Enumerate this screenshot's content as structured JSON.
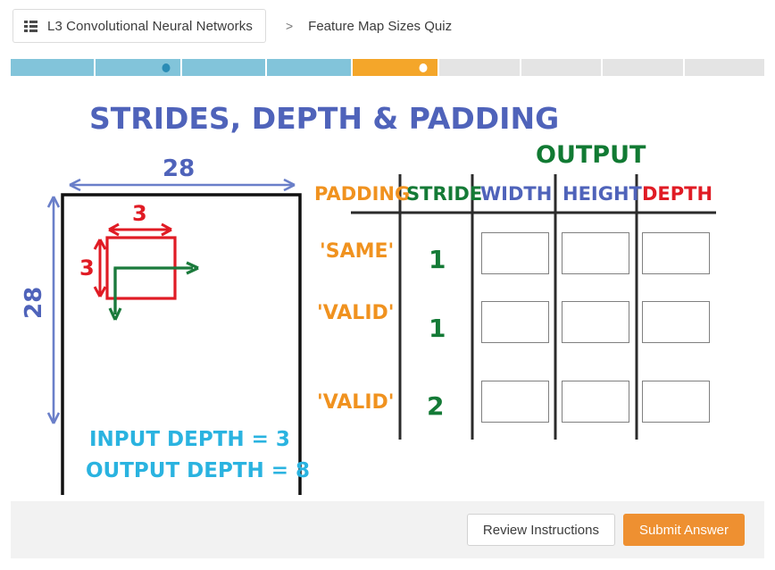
{
  "breadcrumb": {
    "menu_icon": "list-icon",
    "course": "L3 Convolutional Neural Networks",
    "separator": ">",
    "current": "Feature Map Sizes Quiz"
  },
  "progress": {
    "segments": [
      {
        "state": "complete",
        "color": "#82c4da",
        "dot": null
      },
      {
        "state": "complete",
        "color": "#82c4da",
        "dot": "#2b8cb5"
      },
      {
        "state": "complete",
        "color": "#82c4da",
        "dot": null
      },
      {
        "state": "complete",
        "color": "#82c4da",
        "dot": null
      },
      {
        "state": "current",
        "color": "#f4a62a",
        "dot": "#ffffff"
      },
      {
        "state": "upcoming",
        "color": "#e4e4e4",
        "dot": null
      },
      {
        "state": "upcoming",
        "color": "#e4e4e4",
        "dot": null
      },
      {
        "state": "upcoming",
        "color": "#e4e4e4",
        "dot": null
      },
      {
        "state": "upcoming",
        "color": "#e4e4e4",
        "dot": null
      }
    ]
  },
  "board": {
    "title": "STRIDES, DEPTH & PADDING",
    "output_label": "OUTPUT",
    "input": {
      "width_label": "28",
      "height_label": "28",
      "filter_width_label": "3",
      "filter_height_label": "3",
      "input_depth_text": "INPUT DEPTH = 3",
      "output_depth_text": "OUTPUT DEPTH = 8"
    },
    "colors": {
      "title": "#4f63ba",
      "output": "#117a33",
      "padding": "#f0921f",
      "stride": "#147a36",
      "width": "#4f63ba",
      "height": "#4f63ba",
      "depth": "#e01b24",
      "dimension": "#6a7fc9",
      "filter": "#e01b24",
      "arrow": "#1b7a3c",
      "depth_text": "#2ab3e0",
      "square": "#111111"
    },
    "table": {
      "headers": [
        {
          "label": "PADDING",
          "color": "#f0921f"
        },
        {
          "label": "STRIDE",
          "color": "#147a36"
        },
        {
          "label": "WIDTH",
          "color": "#4f63ba"
        },
        {
          "label": "HEIGHT",
          "color": "#4f63ba"
        },
        {
          "label": "DEPTH",
          "color": "#e01b24"
        }
      ],
      "rows": [
        {
          "padding": "'SAME'",
          "stride": "1",
          "width": "",
          "height": "",
          "depth": ""
        },
        {
          "padding": "'VALID'",
          "stride": "1",
          "width": "",
          "height": "",
          "depth": ""
        },
        {
          "padding": "'VALID'",
          "stride": "2",
          "width": "",
          "height": "",
          "depth": ""
        }
      ],
      "answer_placeholder": ""
    }
  },
  "footer": {
    "review_label": "Review Instructions",
    "submit_label": "Submit Answer"
  }
}
